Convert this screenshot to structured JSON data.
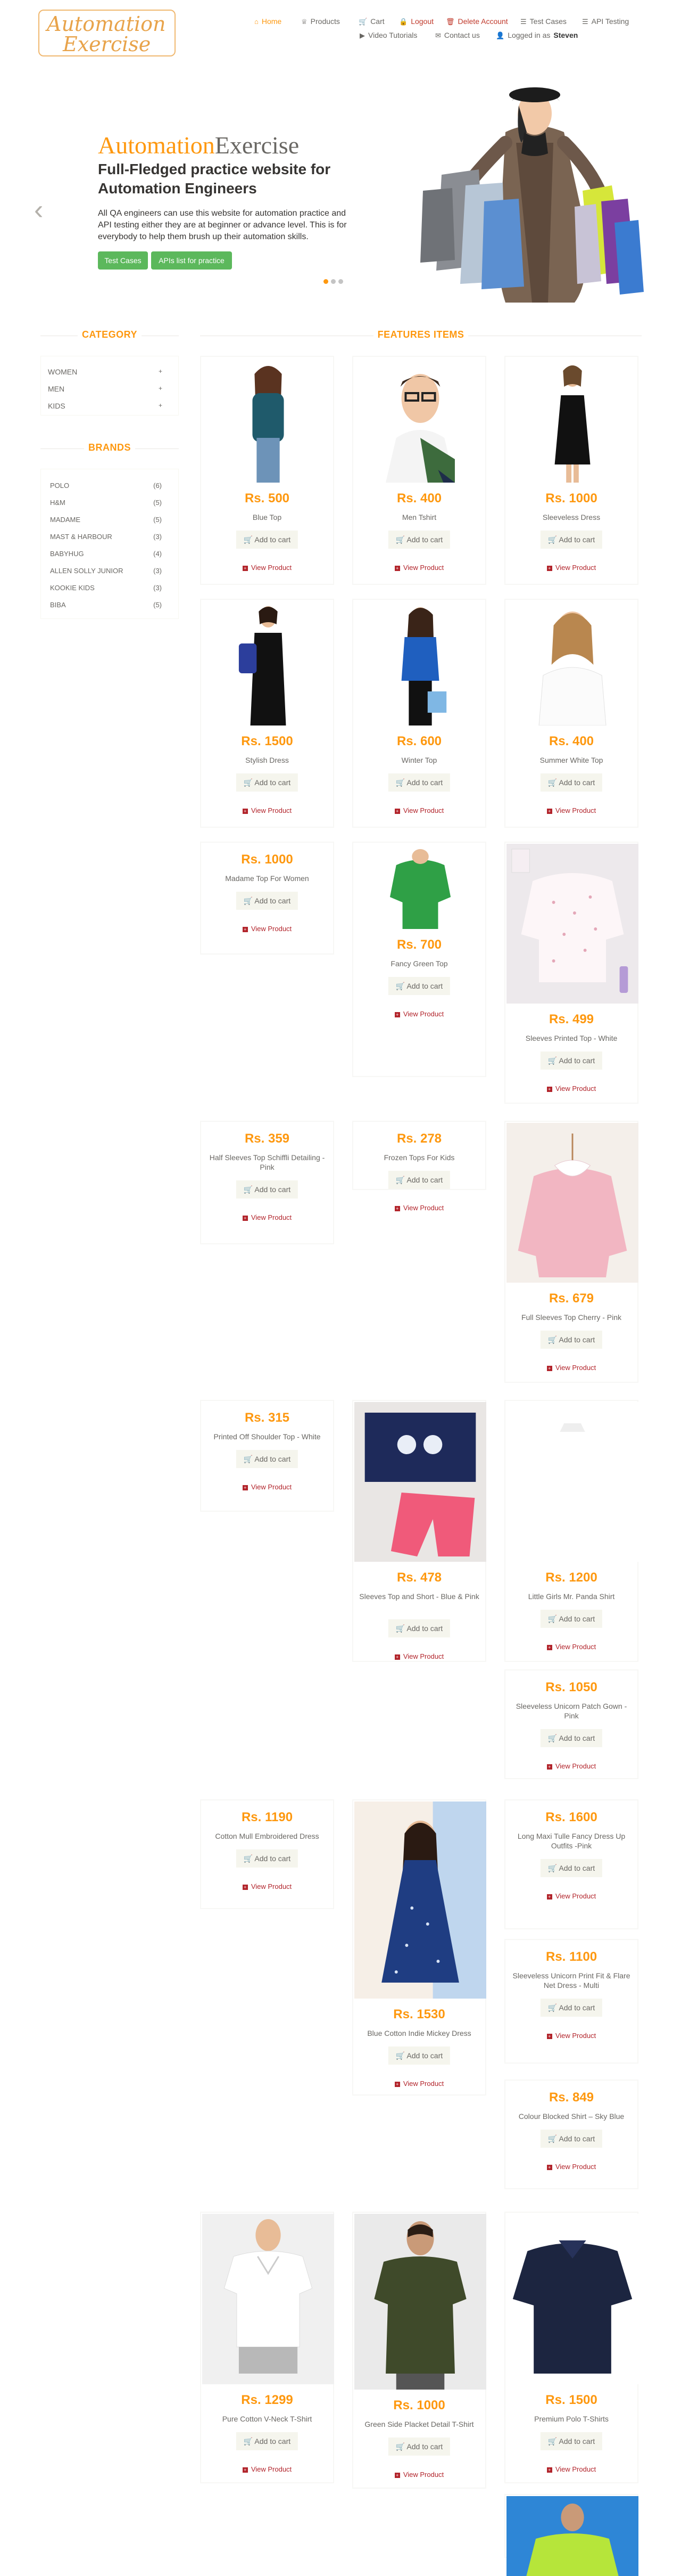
{
  "logo": {
    "line1": "Automation",
    "line2": "Exercise"
  },
  "nav": [
    {
      "label": "Home",
      "icon": "home-icon",
      "glyph": "⌂"
    },
    {
      "label": "Products",
      "icon": "products-icon",
      "glyph": "♕"
    },
    {
      "label": "Cart",
      "icon": "cart-icon",
      "glyph": "🛒"
    },
    {
      "label": "Logout",
      "icon": "lock-icon",
      "glyph": "🔒"
    },
    {
      "label": "Delete Account",
      "icon": "trash-icon",
      "glyph": "🗑"
    },
    {
      "label": "Test Cases",
      "icon": "list-icon",
      "glyph": "☰"
    },
    {
      "label": "API Testing",
      "icon": "list-icon",
      "glyph": "☰"
    },
    {
      "label": "Video Tutorials",
      "icon": "youtube-icon",
      "glyph": "▶"
    },
    {
      "label": "Contact us",
      "icon": "envelope-icon",
      "glyph": "✉"
    }
  ],
  "logged_in": {
    "prefix": "Logged in as",
    "user": "Steven"
  },
  "slider": {
    "brand_a": "Automation",
    "brand_b": "Exercise",
    "heading": "Full-Fledged practice website for Automation Engineers",
    "text": "All QA engineers can use this website for automation practice and API testing either they are at beginner or advance level. This is for everybody to help them brush up their automation skills.",
    "btn_test_cases": "Test Cases",
    "btn_apis": "APIs list for practice",
    "prev": "‹",
    "next": "›"
  },
  "sidebar": {
    "category_title": "CATEGORY",
    "categories": [
      {
        "label": "Women",
        "plus": "+"
      },
      {
        "label": "Men",
        "plus": "+"
      },
      {
        "label": "Kids",
        "plus": "+"
      }
    ],
    "brands_title": "BRANDS",
    "brands": [
      {
        "name": "Polo",
        "count": "(6)"
      },
      {
        "name": "H&M",
        "count": "(5)"
      },
      {
        "name": "Madame",
        "count": "(5)"
      },
      {
        "name": "Mast & Harbour",
        "count": "(3)"
      },
      {
        "name": "Babyhug",
        "count": "(4)"
      },
      {
        "name": "Allen Solly Junior",
        "count": "(3)"
      },
      {
        "name": "Kookie Kids",
        "count": "(3)"
      },
      {
        "name": "Biba",
        "count": "(5)"
      }
    ]
  },
  "features_title": "FEATURES ITEMS",
  "add_to_cart": "Add to cart",
  "view_product": "View Product",
  "products": [
    {
      "price": "Rs. 500",
      "name": "Blue Top"
    },
    {
      "price": "Rs. 400",
      "name": "Men Tshirt"
    },
    {
      "price": "Rs. 1000",
      "name": "Sleeveless Dress"
    },
    {
      "price": "Rs. 1500",
      "name": "Stylish Dress"
    },
    {
      "price": "Rs. 600",
      "name": "Winter Top"
    },
    {
      "price": "Rs. 400",
      "name": "Summer White Top"
    },
    {
      "price": "Rs. 1000",
      "name": "Madame Top For Women"
    },
    {
      "price": "Rs. 700",
      "name": "Fancy Green Top"
    },
    {
      "price": "Rs. 499",
      "name": "Sleeves Printed Top - White"
    },
    {
      "price": "Rs. 359",
      "name": "Half Sleeves Top Schiffli Detailing - Pink"
    },
    {
      "price": "Rs. 278",
      "name": "Frozen Tops For Kids"
    },
    {
      "price": "Rs. 679",
      "name": "Full Sleeves Top Cherry - Pink"
    },
    {
      "price": "Rs. 315",
      "name": "Printed Off Shoulder Top - White"
    },
    {
      "price": "Rs. 478",
      "name": "Sleeves Top and Short - Blue & Pink"
    },
    {
      "price": "Rs. 1200",
      "name": "Little Girls Mr. Panda Shirt"
    },
    {
      "price": "Rs. 1050",
      "name": "Sleeveless Unicorn Patch Gown - Pink"
    },
    {
      "price": "Rs. 1190",
      "name": "Cotton Mull Embroidered Dress"
    },
    {
      "price": "Rs. 1530",
      "name": "Blue Cotton Indie Mickey Dress"
    },
    {
      "price": "Rs. 1600",
      "name": "Long Maxi Tulle Fancy Dress Up Outfits -Pink"
    },
    {
      "price": "Rs. 1100",
      "name": "Sleeveless Unicorn Print Fit & Flare Net Dress - Multi"
    },
    {
      "price": "Rs. 849",
      "name": "Colour Blocked Shirt – Sky Blue"
    },
    {
      "price": "Rs. 1299",
      "name": "Pure Cotton V-Neck T-Shirt"
    },
    {
      "price": "Rs. 1000",
      "name": "Green Side Placket Detail T-Shirt"
    },
    {
      "price": "Rs. 1500",
      "name": "Premium Polo T-Shirts"
    },
    {
      "price": "",
      "name": ""
    }
  ],
  "colors": {
    "accent": "#fe980f",
    "green": "#5cb85c",
    "view": "#b2242b"
  }
}
